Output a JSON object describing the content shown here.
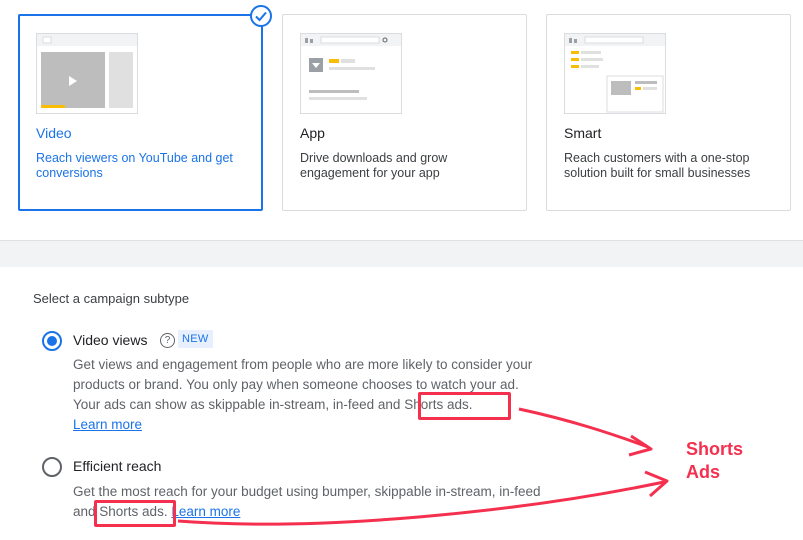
{
  "campaign_types": [
    {
      "title": "Video",
      "desc": "Reach viewers on YouTube and get conversions",
      "selected": true
    },
    {
      "title": "App",
      "desc": "Drive downloads and grow engagement for your app",
      "selected": false
    },
    {
      "title": "Smart",
      "desc": "Reach customers with a one-stop solution built for small businesses",
      "selected": false
    }
  ],
  "subtype": {
    "heading": "Select a campaign subtype",
    "options": [
      {
        "title": "Video views",
        "badge": "NEW",
        "help_glyph": "?",
        "desc_line1": "Get views and engagement from people who are more likely to consider your",
        "desc_line2": "products or brand. You only pay when someone chooses to watch your ad.",
        "desc_line3_pre": "Your ads can show as skippable in-stream, in-feed and ",
        "desc_line3_hl": "Shorts ads.",
        "learn_more": "Learn more",
        "checked": true
      },
      {
        "title": "Efficient reach",
        "desc_line1": "Get the most reach for your budget using bumper, skippable in-stream, in-feed",
        "desc_line2_pre": "and ",
        "desc_line2_hl": "Shorts ads.",
        "learn_more": "Learn more",
        "checked": false
      }
    ]
  },
  "annotation": {
    "line1": "Shorts",
    "line2": "Ads",
    "color": "#f4304e"
  },
  "colors": {
    "accent": "#1a73e8",
    "border": "#dadce0",
    "annotation_red": "#f4304e"
  }
}
